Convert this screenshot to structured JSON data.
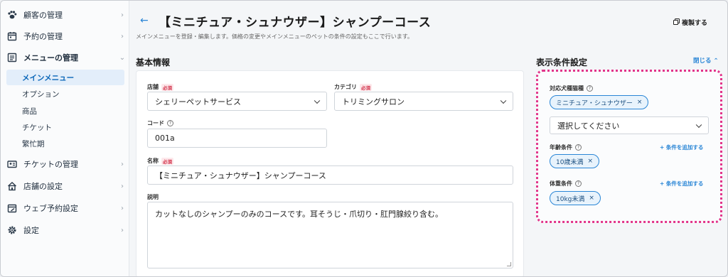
{
  "sidebar": {
    "items": [
      {
        "label": "顧客の管理",
        "icon": "paw-icon"
      },
      {
        "label": "予約の管理",
        "icon": "calendar-icon"
      },
      {
        "label": "メニューの管理",
        "icon": "list-icon"
      },
      {
        "label": "チケットの管理",
        "icon": "ticket-icon"
      },
      {
        "label": "店舗の設定",
        "icon": "store-icon"
      },
      {
        "label": "ウェブ予約設定",
        "icon": "web-booking-icon"
      },
      {
        "label": "設定",
        "icon": "gear-icon"
      }
    ],
    "sub_items": [
      "メインメニュー",
      "オプション",
      "商品",
      "チケット",
      "繁忙期"
    ]
  },
  "header": {
    "title": "【ミニチュア・シュナウザー】シャンプーコース",
    "description": "メインメニューを登録・編集します。価格の変更やメインメニューのペットの条件の設定もここで行います。",
    "duplicate_label": "複製する"
  },
  "basic_info": {
    "title": "基本情報",
    "required_label": "必須",
    "store": {
      "label": "店舗",
      "value": "シェリーペットサービス"
    },
    "category": {
      "label": "カテゴリ",
      "value": "トリミングサロン"
    },
    "code": {
      "label": "コード",
      "value": "001a"
    },
    "name": {
      "label": "名称",
      "value": "【ミニチュア・シュナウザー】シャンプーコース"
    },
    "description": {
      "label": "説明",
      "value": "カットなしのシャンプーのみのコースです。耳そうじ・爪切り・肛門腺絞り含む。"
    }
  },
  "conditions": {
    "title": "表示条件設定",
    "close_label": "閉じる",
    "breed": {
      "label": "対応犬種猫種",
      "chip": "ミニチュア・シュナウザー",
      "select_placeholder": "選択してください"
    },
    "age": {
      "label": "年齢条件",
      "chip": "10歳未満",
      "add_label": "+ 条件を追加する"
    },
    "weight": {
      "label": "体重条件",
      "chip": "10kg未満",
      "add_label": "+ 条件を追加する"
    }
  },
  "colors": {
    "accent": "#2a86d6",
    "highlight": "#e2348a",
    "required": "#d2334b"
  }
}
